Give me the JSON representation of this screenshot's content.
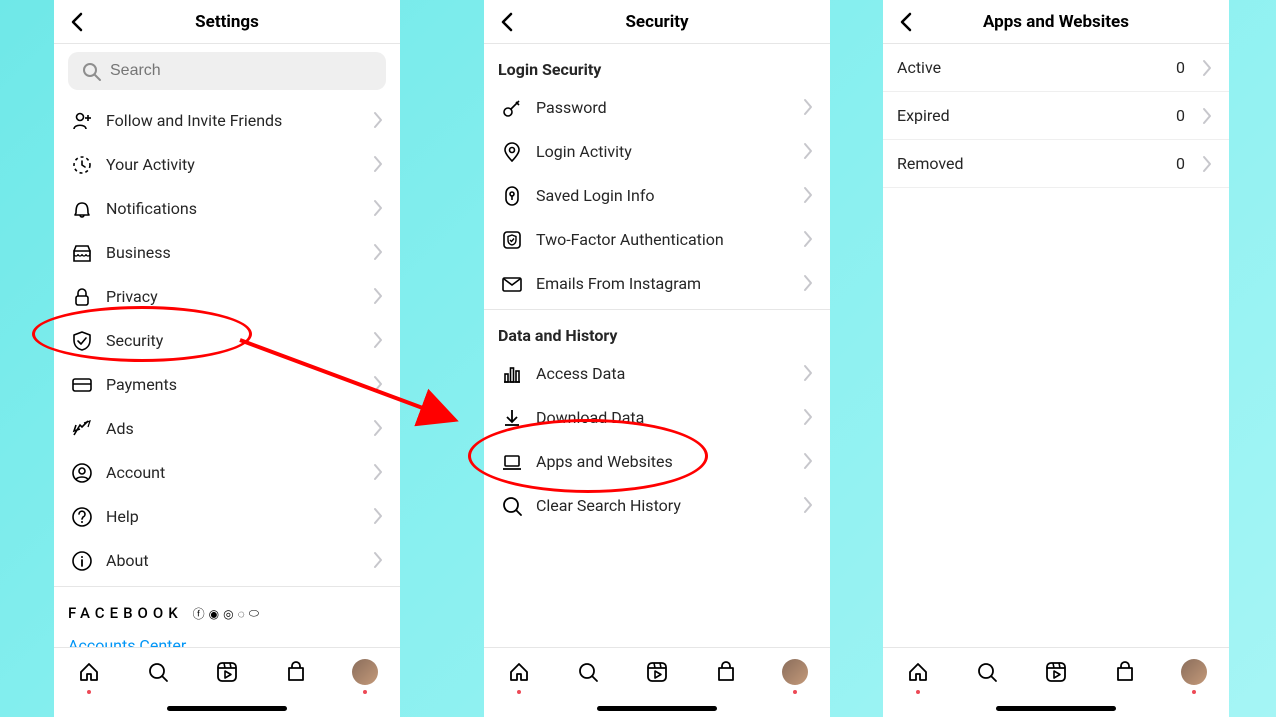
{
  "screens": {
    "settings": {
      "title": "Settings",
      "search_placeholder": "Search",
      "items": [
        {
          "icon": "invite",
          "label": "Follow and Invite Friends"
        },
        {
          "icon": "activity",
          "label": "Your Activity"
        },
        {
          "icon": "bell",
          "label": "Notifications"
        },
        {
          "icon": "business",
          "label": "Business"
        },
        {
          "icon": "lock",
          "label": "Privacy"
        },
        {
          "icon": "shield",
          "label": "Security"
        },
        {
          "icon": "payments",
          "label": "Payments"
        },
        {
          "icon": "ads",
          "label": "Ads"
        },
        {
          "icon": "account",
          "label": "Account"
        },
        {
          "icon": "help",
          "label": "Help"
        },
        {
          "icon": "about",
          "label": "About"
        }
      ],
      "facebook_label": "FACEBOOK",
      "accounts_center": "Accounts Center"
    },
    "security": {
      "title": "Security",
      "section1": "Login Security",
      "items1": [
        {
          "icon": "key",
          "label": "Password"
        },
        {
          "icon": "pin",
          "label": "Login Activity"
        },
        {
          "icon": "keyhole",
          "label": "Saved Login Info"
        },
        {
          "icon": "twofa",
          "label": "Two-Factor Authentication"
        },
        {
          "icon": "mail",
          "label": "Emails From Instagram"
        }
      ],
      "section2": "Data and History",
      "items2": [
        {
          "icon": "bars",
          "label": "Access Data"
        },
        {
          "icon": "download",
          "label": "Download Data"
        },
        {
          "icon": "laptop",
          "label": "Apps and Websites"
        },
        {
          "icon": "searchclear",
          "label": "Clear Search History"
        }
      ]
    },
    "apps": {
      "title": "Apps and Websites",
      "rows": [
        {
          "label": "Active",
          "count": "0"
        },
        {
          "label": "Expired",
          "count": "0"
        },
        {
          "label": "Removed",
          "count": "0"
        }
      ]
    }
  }
}
